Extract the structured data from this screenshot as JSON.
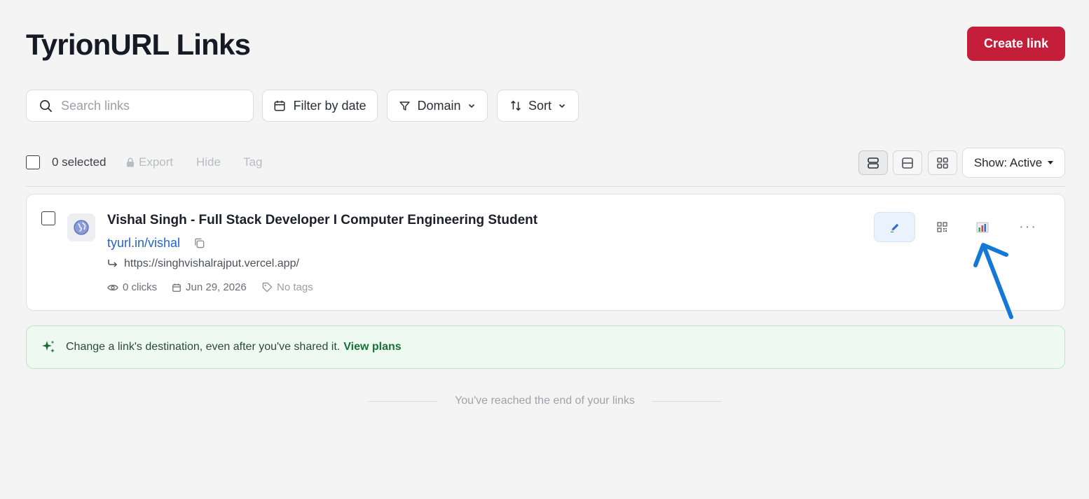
{
  "header": {
    "title": "TyrionURL Links",
    "create_label": "Create link"
  },
  "toolbar": {
    "search_placeholder": "Search links",
    "filter_date_label": "Filter by date",
    "domain_label": "Domain",
    "sort_label": "Sort"
  },
  "bulk": {
    "selected_label": "0 selected",
    "export_label": "Export",
    "hide_label": "Hide",
    "tag_label": "Tag",
    "show_label": "Show: Active"
  },
  "links": [
    {
      "title": "Vishal Singh - Full Stack Developer I Computer Engineering Student",
      "short_url": "tyurl.in/vishal",
      "destination": "https://singhvishalrajput.vercel.app/",
      "clicks": "0 clicks",
      "date": "Jun 29, 2026",
      "tags": "No tags"
    }
  ],
  "banner": {
    "message": "Change a link's destination, even after you've shared it.",
    "cta": "View plans"
  },
  "footer": {
    "end_text": "You've reached the end of your links"
  },
  "icons": {
    "search": "search-icon",
    "calendar": "calendar-icon",
    "filter": "filter-icon",
    "chevron": "chevron-down-icon",
    "sort": "sort-icon",
    "lock": "lock-icon",
    "globe": "globe-icon",
    "copy": "copy-icon",
    "redirect": "redirect-arrow-icon",
    "eye": "eye-icon",
    "tag": "tag-icon",
    "edit": "pencil-icon",
    "qr": "qr-code-icon",
    "stats": "bar-chart-icon",
    "more": "more-icon",
    "sparkle": "sparkle-icon"
  },
  "colors": {
    "brand": "#c41e3a",
    "link": "#2563c9",
    "annotation": "#1479d6",
    "banner_bg": "#eefaf1"
  }
}
